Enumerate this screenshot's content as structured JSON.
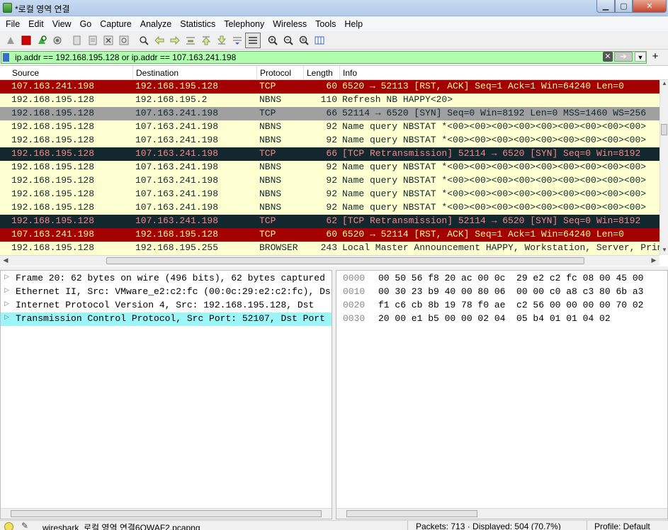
{
  "window": {
    "title": "*로컬 영역 연결",
    "controls": [
      "minimize-icon",
      "maximize-icon",
      "close-icon"
    ]
  },
  "menu": [
    "File",
    "Edit",
    "View",
    "Go",
    "Capture",
    "Analyze",
    "Statistics",
    "Telephony",
    "Wireless",
    "Tools",
    "Help"
  ],
  "toolbar": {
    "icons": [
      "shark-fin-start-icon",
      "stop-icon",
      "restart-icon",
      "options-gear-icon",
      "open-file-icon",
      "save-file-icon",
      "close-file-icon",
      "reload-icon",
      "find-icon",
      "back-arrow-icon",
      "forward-arrow-icon",
      "go-to-packet-icon",
      "first-packet-icon",
      "last-packet-icon",
      "autoscroll-icon",
      "colorize-icon",
      "zoom-in-icon",
      "zoom-out-icon",
      "zoom-normal-icon",
      "resize-columns-icon"
    ]
  },
  "filter": {
    "value": "ip.addr == 192.168.195.128 or ip.addr == 107.163.241.198"
  },
  "packet_list": {
    "columns": [
      "Source",
      "Destination",
      "Protocol",
      "Length",
      "Info"
    ],
    "rows": [
      {
        "src": "107.163.241.198",
        "dst": "192.168.195.128",
        "proto": "TCP",
        "len": "60",
        "info": "6520 → 52113 [RST, ACK] Seq=1 Ack=1 Win=64240 Len=0",
        "style": "rst"
      },
      {
        "src": "192.168.195.128",
        "dst": "192.168.195.2",
        "proto": "NBNS",
        "len": "110",
        "info": "Refresh NB HAPPY<20>",
        "style": "nbns"
      },
      {
        "src": "192.168.195.128",
        "dst": "107.163.241.198",
        "proto": "TCP",
        "len": "66",
        "info": "52114 → 6520 [SYN] Seq=0 Win=8192 Len=0 MSS=1460 WS=256",
        "style": "syn"
      },
      {
        "src": "192.168.195.128",
        "dst": "107.163.241.198",
        "proto": "NBNS",
        "len": "92",
        "info": "Name query NBSTAT *<00><00><00><00><00><00><00><00><00>",
        "style": "nbns"
      },
      {
        "src": "192.168.195.128",
        "dst": "107.163.241.198",
        "proto": "NBNS",
        "len": "92",
        "info": "Name query NBSTAT *<00><00><00><00><00><00><00><00><00>",
        "style": "nbns"
      },
      {
        "src": "192.168.195.128",
        "dst": "107.163.241.198",
        "proto": "TCP",
        "len": "66",
        "info": "[TCP Retransmission] 52114 → 6520 [SYN] Seq=0 Win=8192",
        "style": "retrans"
      },
      {
        "src": "192.168.195.128",
        "dst": "107.163.241.198",
        "proto": "NBNS",
        "len": "92",
        "info": "Name query NBSTAT *<00><00><00><00><00><00><00><00><00>",
        "style": "nbns"
      },
      {
        "src": "192.168.195.128",
        "dst": "107.163.241.198",
        "proto": "NBNS",
        "len": "92",
        "info": "Name query NBSTAT *<00><00><00><00><00><00><00><00><00>",
        "style": "nbns"
      },
      {
        "src": "192.168.195.128",
        "dst": "107.163.241.198",
        "proto": "NBNS",
        "len": "92",
        "info": "Name query NBSTAT *<00><00><00><00><00><00><00><00><00>",
        "style": "nbns"
      },
      {
        "src": "192.168.195.128",
        "dst": "107.163.241.198",
        "proto": "NBNS",
        "len": "92",
        "info": "Name query NBSTAT *<00><00><00><00><00><00><00><00><00>",
        "style": "nbns"
      },
      {
        "src": "192.168.195.128",
        "dst": "107.163.241.198",
        "proto": "TCP",
        "len": "62",
        "info": "[TCP Retransmission] 52114 → 6520 [SYN] Seq=0 Win=8192",
        "style": "retrans"
      },
      {
        "src": "107.163.241.198",
        "dst": "192.168.195.128",
        "proto": "TCP",
        "len": "60",
        "info": "6520 → 52114 [RST, ACK] Seq=1 Ack=1 Win=64240 Len=0",
        "style": "rst"
      },
      {
        "src": "192.168.195.128",
        "dst": "192.168.195.255",
        "proto": "BROWSER",
        "len": "243",
        "info": "Local Master Announcement HAPPY, Workstation, Server, Print",
        "style": "nbns"
      }
    ]
  },
  "row_styles": {
    "rst": {
      "bg": "#a40000",
      "fg": "#fffc9c"
    },
    "nbns": {
      "bg": "#feffd0",
      "fg": "#12272e"
    },
    "syn": {
      "bg": "#a0a0a0",
      "fg": "#12272e"
    },
    "retrans": {
      "bg": "#12272e",
      "fg": "#f78787"
    }
  },
  "details": [
    {
      "text": "Frame 20: 62 bytes on wire (496 bits), 62 bytes captured",
      "selected": false
    },
    {
      "text": "Ethernet II, Src: VMware_e2:c2:fc (00:0c:29:e2:c2:fc), Dst",
      "selected": false
    },
    {
      "text": "Internet Protocol Version 4, Src: 192.168.195.128, Dst",
      "selected": false
    },
    {
      "text": "Transmission Control Protocol, Src Port: 52107, Dst Port",
      "selected": true
    }
  ],
  "bytes": [
    {
      "offset": "0000",
      "hex": "00 50 56 f8 20 ac 00 0c  29 e2 c2 fc 08 00 45 00"
    },
    {
      "offset": "0010",
      "hex": "00 30 23 b9 40 00 80 06  00 00 c0 a8 c3 80 6b a3"
    },
    {
      "offset": "0020",
      "hex": "f1 c6 cb 8b 19 78 f0 ae  c2 56 00 00 00 00 70 02"
    },
    {
      "offset": "0030",
      "hex": "20 00 e1 b5 00 00 02 04  05 b4 01 01 04 02"
    }
  ],
  "status": {
    "file": "wireshark_로컬 영역 연결6QWAF2.pcapng",
    "packets": "Packets: 713 · Displayed: 504 (70.7%)",
    "profile": "Profile: Default"
  }
}
